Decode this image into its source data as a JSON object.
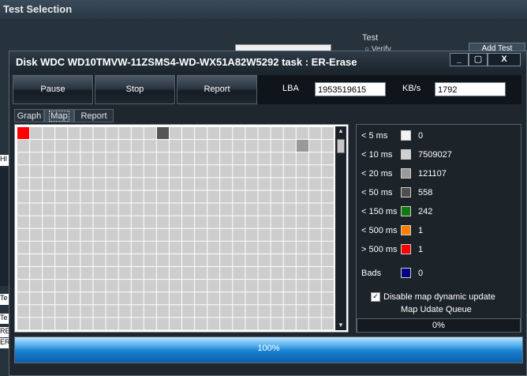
{
  "background_window": {
    "title": "Test Selection",
    "test_label": "Test",
    "radio_label": "Verify",
    "add_button": "Add Test",
    "side_labels": [
      "HI",
      "Te",
      "Te",
      "RE",
      "ER"
    ]
  },
  "dialog": {
    "title": "Disk WDC WD10TMVW-11ZSMS4-WD-WX51A82W5292   task : ER-Erase",
    "controls": {
      "minimize": "_",
      "maximize": "▢",
      "close": "X"
    },
    "toolbar": {
      "pause": "Pause",
      "stop": "Stop",
      "report": "Report",
      "lba_label": "LBA",
      "lba_value": "1953519615",
      "kbs_label": "KB/s",
      "kbs_value": "1792"
    },
    "tabs": [
      {
        "label": "Graph",
        "active": false
      },
      {
        "label": "Map",
        "active": true
      },
      {
        "label": "Report",
        "active": false
      }
    ],
    "legend": [
      {
        "label": "< 5 ms",
        "color": "#f2f2f2",
        "value": "0"
      },
      {
        "label": "< 10 ms",
        "color": "#d0d0d0",
        "value": "7509027"
      },
      {
        "label": "< 20 ms",
        "color": "#9a9a9a",
        "value": "121107"
      },
      {
        "label": "< 50 ms",
        "color": "#4e4e4e",
        "value": "558"
      },
      {
        "label": "< 150 ms",
        "color": "#0f7a0f",
        "value": "242"
      },
      {
        "label": "< 500 ms",
        "color": "#ff8000",
        "value": "1"
      },
      {
        "label": "> 500 ms",
        "color": "#ff0000",
        "value": "1"
      },
      {
        "label": "Bads",
        "color": "#000080",
        "value": "0"
      }
    ],
    "disable_map_update": {
      "label": "Disable map dynamic update",
      "checked": true
    },
    "queue_label": "Map Udate Queue",
    "queue_value": "0%",
    "progress_text": "100%",
    "progress": 1.0
  },
  "map_cells": [
    {
      "col": 0,
      "row": 0,
      "color": "#ff0000"
    },
    {
      "col": 11,
      "row": 0,
      "color": "#555555"
    },
    {
      "col": 22,
      "row": 1,
      "color": "#999999"
    }
  ]
}
